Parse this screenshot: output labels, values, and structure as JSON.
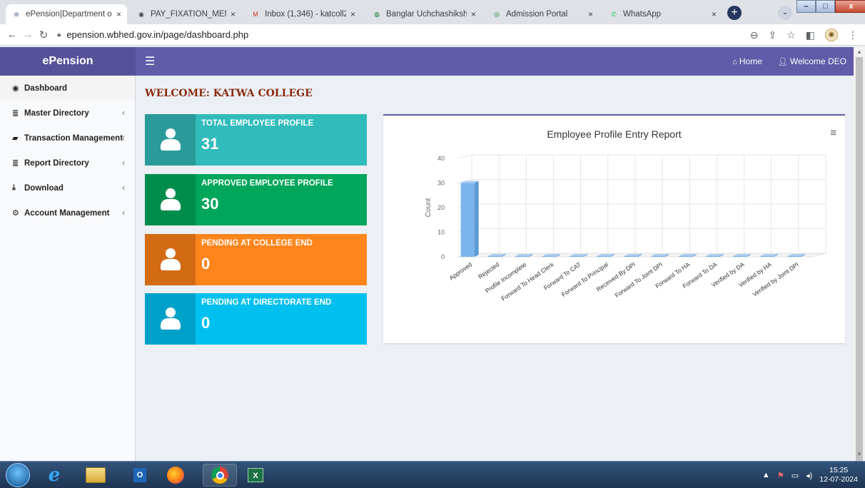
{
  "browser": {
    "tabs": [
      {
        "title": "ePension|Department o",
        "close": "×",
        "fav": "⊕",
        "color": "#5a6f99",
        "active": true
      },
      {
        "title": "PAY_FIXATION_MEMO_",
        "close": "×",
        "fav": "◉",
        "color": "#3c4043",
        "active": false
      },
      {
        "title": "Inbox (1,346) - katcoll2",
        "close": "×",
        "fav": "M",
        "color": "#d93025",
        "active": false
      },
      {
        "title": "Banglar Uchchashiksha",
        "close": "×",
        "fav": "◍",
        "color": "#188038",
        "active": false
      },
      {
        "title": "Admission Portal",
        "close": "×",
        "fav": "◎",
        "color": "#188038",
        "active": false
      },
      {
        "title": "WhatsApp",
        "close": "×",
        "fav": "✆",
        "color": "#25d366",
        "active": false
      }
    ],
    "new_tab": "+",
    "url": "epension.wbhed.gov.in/page/dashboard.php"
  },
  "app": {
    "brand": "ePension",
    "nav": {
      "home": "Home",
      "user": "Welcome DEO"
    },
    "sidebar": [
      {
        "label": "Dashboard",
        "icon": "dashboard-icon",
        "glyph": "◉",
        "chevron": ""
      },
      {
        "label": "Master Directory",
        "icon": "database-icon",
        "glyph": "≣",
        "chevron": "‹"
      },
      {
        "label": "Transaction Management",
        "icon": "book-icon",
        "glyph": "▰",
        "chevron": "‹"
      },
      {
        "label": "Report Directory",
        "icon": "database-icon",
        "glyph": "≣",
        "chevron": "‹"
      },
      {
        "label": "Download",
        "icon": "download-icon",
        "glyph": "⤓",
        "chevron": "‹"
      },
      {
        "label": "Account Management",
        "icon": "cogs-icon",
        "glyph": "⚙",
        "chevron": "‹"
      }
    ],
    "welcome": "WELCOME: KATWA COLLEGE",
    "boxes": [
      {
        "label": "TOTAL EMPLOYEE PROFILE",
        "value": "31",
        "color": "#31bbbb",
        "dark": "#2a9a9a"
      },
      {
        "label": "APPROVED EMPLOYEE PROFILE",
        "value": "30",
        "color": "#00a65a",
        "dark": "#008d4c"
      },
      {
        "label": "PENDING AT COLLEGE END",
        "value": "0",
        "color": "#ff851b",
        "dark": "#d26b14"
      },
      {
        "label": "PENDING AT DIRECTORATE END",
        "value": "0",
        "color": "#00c0ef",
        "dark": "#00a1c9"
      }
    ],
    "chart_title": "Employee Profile Entry Report"
  },
  "chart_data": {
    "type": "bar",
    "title": "Employee Profile Entry Report",
    "xlabel": "",
    "ylabel": "Count",
    "ylim": [
      0,
      40
    ],
    "yticks": [
      0,
      10,
      20,
      30,
      40
    ],
    "categories": [
      "Approved",
      "Rejected",
      "Profile Incomplete",
      "Forward To Head Clerk",
      "Forward To CAT",
      "Forward To Principal",
      "Received By DPI",
      "Forward To Joint DPI",
      "Forward To HA",
      "Forward To DA",
      "Verified by DA",
      "Verified by HA",
      "Verified by Joint DPI"
    ],
    "values": [
      30,
      0,
      0,
      0,
      0,
      0,
      0,
      0,
      0,
      0,
      0,
      0,
      0
    ],
    "color": "#7cb5ec",
    "grid": true
  },
  "taskbar": {
    "time": "15:25",
    "date": "12-07-2024",
    "apps": [
      "ie-icon",
      "explorer-icon",
      "outlook-icon",
      "firefox-icon",
      "chrome-icon",
      "excel-icon"
    ]
  }
}
